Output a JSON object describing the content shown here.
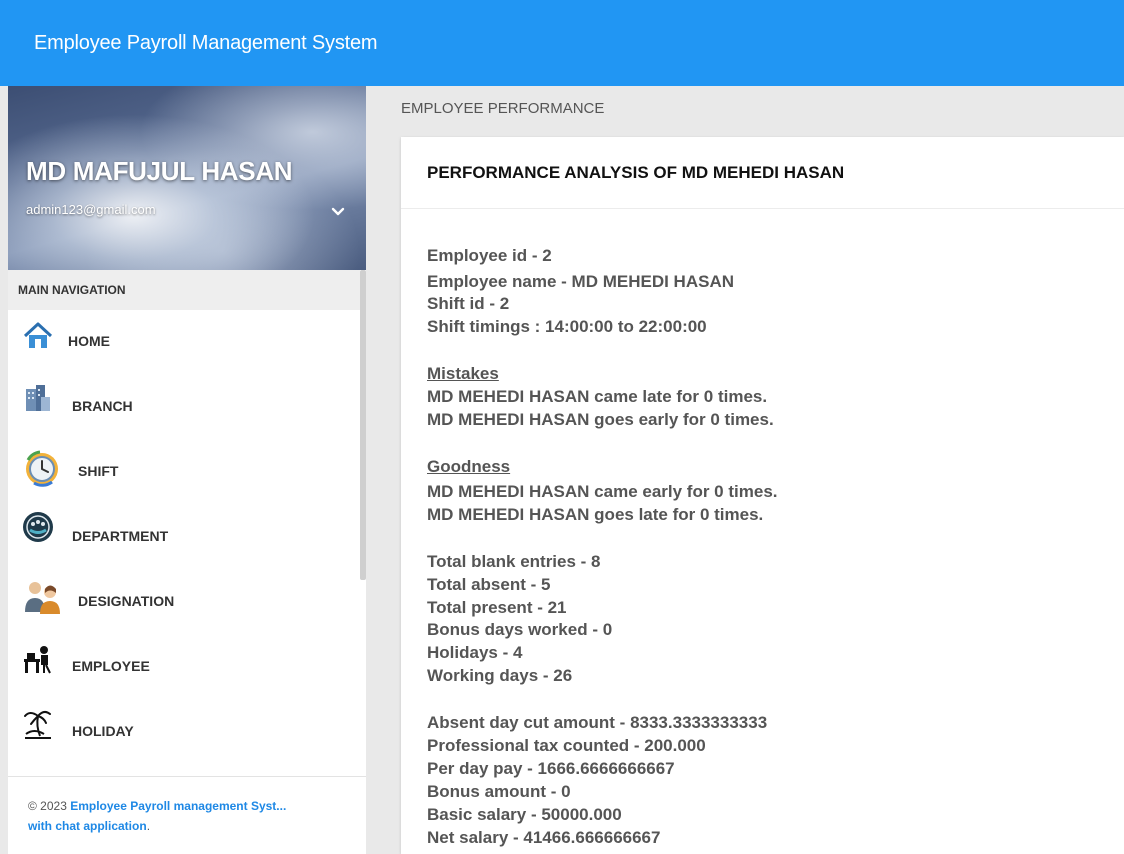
{
  "header": {
    "app_title": "Employee Payroll Management System"
  },
  "user": {
    "name": "MD MAFUJUL HASAN",
    "email": "admin123@gmail.com"
  },
  "nav": {
    "header": "MAIN NAVIGATION",
    "items": [
      {
        "label": "HOME",
        "icon": "home-icon"
      },
      {
        "label": "BRANCH",
        "icon": "building-icon"
      },
      {
        "label": "SHIFT",
        "icon": "clock-icon"
      },
      {
        "label": "DEPARTMENT",
        "icon": "department-icon"
      },
      {
        "label": "DESIGNATION",
        "icon": "people-icon"
      },
      {
        "label": "EMPLOYEE",
        "icon": "employee-desk-icon"
      },
      {
        "label": "HOLIDAY",
        "icon": "palm-tree-icon"
      }
    ]
  },
  "footer": {
    "copyright": "© 2023 ",
    "link_text": "Employee Payroll management Syst...",
    "link_text_2": "with chat application",
    "suffix": "."
  },
  "page": {
    "section_title": "EMPLOYEE PERFORMANCE",
    "card_title": "PERFORMANCE ANALYSIS OF MD MEHEDI HASAN",
    "info": {
      "employee_id": "Employee id - 2",
      "employee_name": "Employee name - MD MEHEDI HASAN",
      "shift_id": "Shift id - 2",
      "shift_timings": "Shift timings : 14:00:00 to 22:00:00"
    },
    "mistakes": {
      "heading": "Mistakes",
      "late": "MD MEHEDI HASAN came late for 0 times.",
      "early": "MD MEHEDI HASAN goes early for 0 times."
    },
    "goodness": {
      "heading": "Goodness",
      "early": "MD MEHEDI HASAN came early for 0 times.",
      "late": "MD MEHEDI HASAN goes late for 0 times."
    },
    "attendance": {
      "blank": "Total blank entries - 8",
      "absent": "Total absent - 5",
      "present": "Total present - 21",
      "bonus_days": "Bonus days worked - 0",
      "holidays": "Holidays - 4",
      "working_days": "Working days - 26"
    },
    "salary": {
      "absent_cut": "Absent day cut amount - 8333.3333333333",
      "prof_tax": "Professional tax counted - 200.000",
      "per_day": "Per day pay - 1666.6666666667",
      "bonus": "Bonus amount - 0",
      "basic": "Basic salary - 50000.000",
      "net": "Net salary - 41466.666666667"
    }
  },
  "colors": {
    "topbar": "#2196f3",
    "link": "#1e88e5"
  }
}
